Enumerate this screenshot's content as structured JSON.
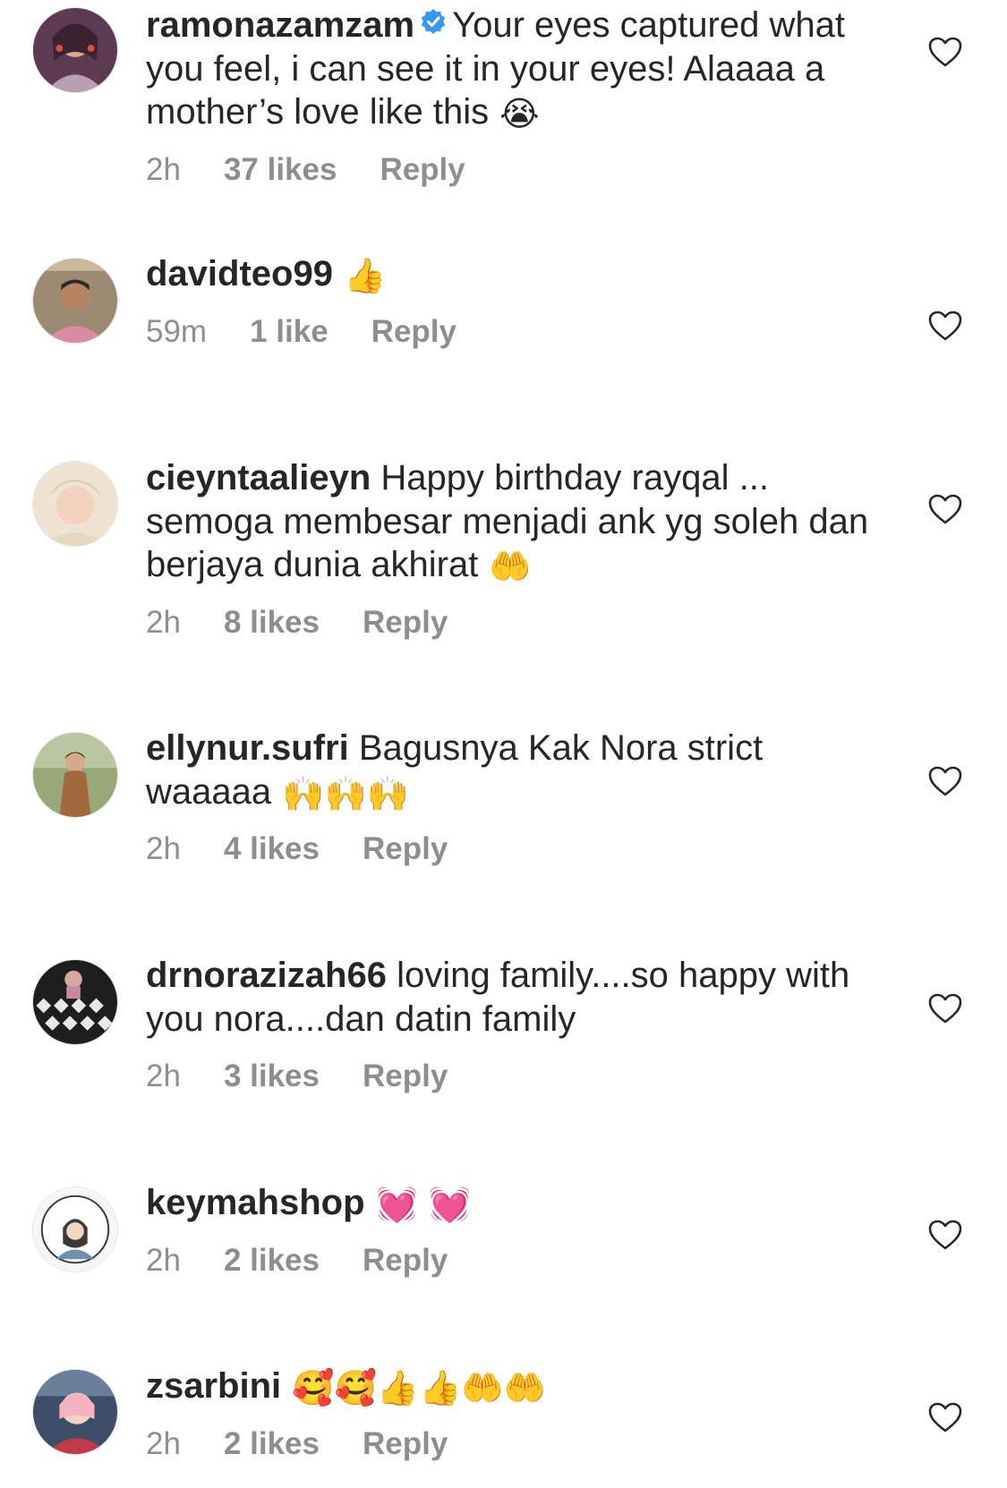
{
  "comments": [
    {
      "username": "ramonazamzam",
      "verified": true,
      "text": "Your eyes captured what you feel, i can see it in your eyes! Alaaaa a mother’s love like this",
      "emoji": "😭",
      "time": "2h",
      "likes": "37 likes",
      "reply": "Reply",
      "avatar_color": "#6b3f5a"
    },
    {
      "username": "davidteo99",
      "verified": false,
      "text": "",
      "emoji": "👍",
      "time": "59m",
      "likes": "1 like",
      "reply": "Reply",
      "avatar_color": "#7d6a52"
    },
    {
      "username": "cieyntaalieyn",
      "verified": false,
      "text": "Happy birthday rayqal ... semoga membesar menjadi ank yg soleh dan berjaya dunia akhirat",
      "emoji": "🤲",
      "time": "2h",
      "likes": "8 likes",
      "reply": "Reply",
      "avatar_color": "#e9dcc6"
    },
    {
      "username": "ellynur.sufri",
      "verified": false,
      "text": "Bagusnya Kak Nora strict waaaaa",
      "emoji": "🙌🙌🙌",
      "time": "2h",
      "likes": "4 likes",
      "reply": "Reply",
      "avatar_color": "#8a9a6a"
    },
    {
      "username": "drnorazizah66",
      "verified": false,
      "text": "loving family....so happy with you nora....dan datin family",
      "emoji": "",
      "time": "2h",
      "likes": "3 likes",
      "reply": "Reply",
      "avatar_color": "#2f2f2f"
    },
    {
      "username": "keymahshop",
      "verified": false,
      "text": "",
      "emoji": "💓 💓",
      "time": "2h",
      "likes": "2 likes",
      "reply": "Reply",
      "avatar_color": "#f4f4f4"
    },
    {
      "username": "zsarbini",
      "verified": false,
      "text": "",
      "emoji": "🥰🥰👍👍🤲🤲",
      "time": "2h",
      "likes": "2 likes",
      "reply": "Reply",
      "avatar_color": "#c94a5a"
    }
  ],
  "colors": {
    "text": "#262626",
    "meta": "#8e8e8e",
    "verified": "#3897f0"
  },
  "icons": {
    "verified": "verified-badge-icon",
    "like": "heart-outline-icon"
  }
}
